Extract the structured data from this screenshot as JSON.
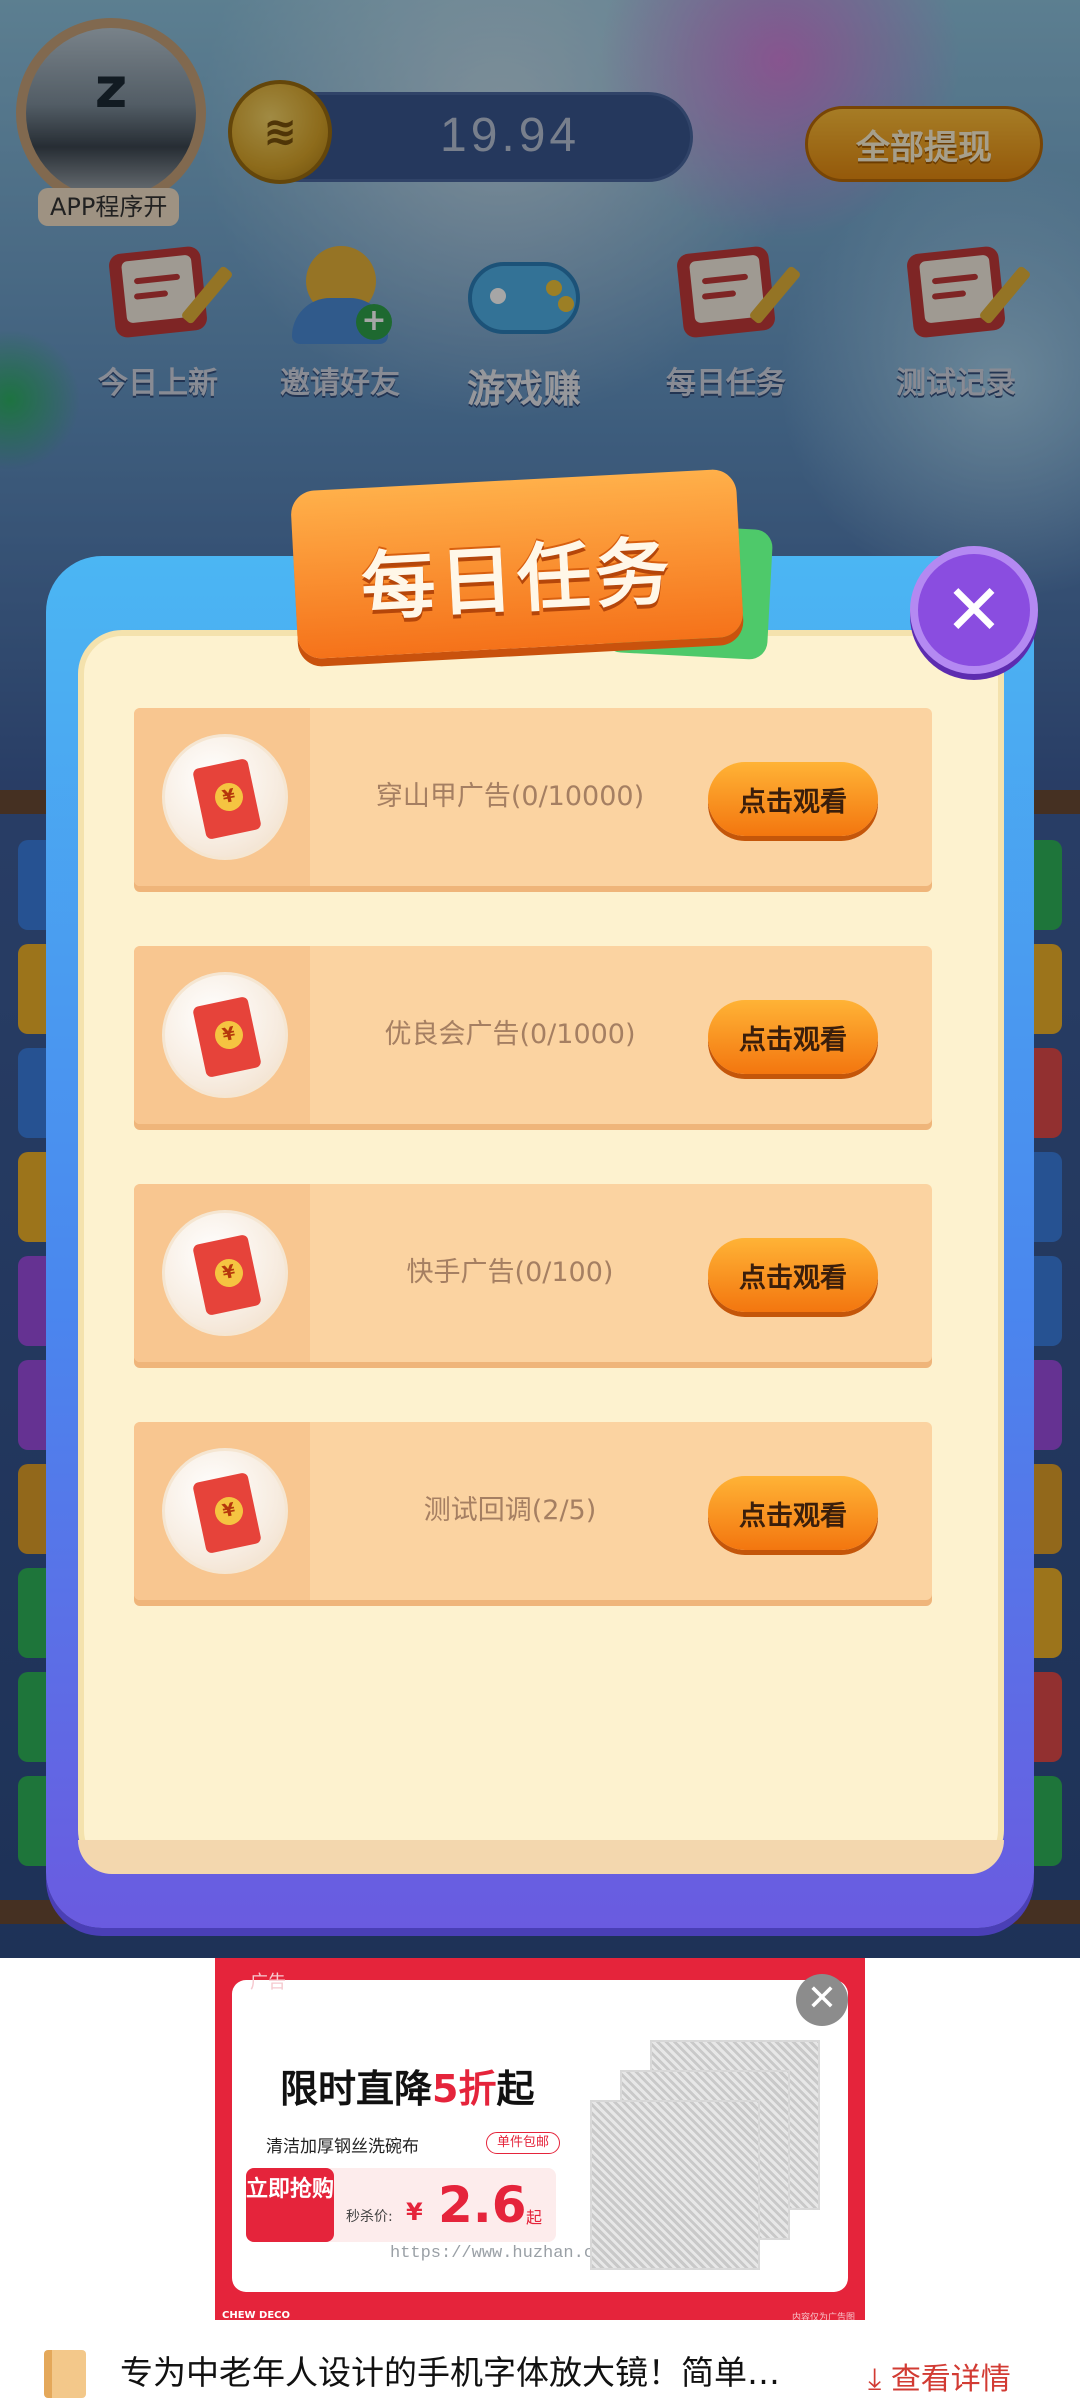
{
  "user": {
    "name": "APP程序开"
  },
  "balance": {
    "value": "19.94"
  },
  "header": {
    "withdraw_label": "全部提现"
  },
  "nav": {
    "items": [
      {
        "label": "今日上新",
        "icon": "document-pencil-icon"
      },
      {
        "label": "邀请好友",
        "icon": "add-friend-icon"
      },
      {
        "label": "游戏赚",
        "icon": "gamepad-coins-icon"
      },
      {
        "label": "每日任务",
        "icon": "document-pencil-icon"
      },
      {
        "label": "测试记录",
        "icon": "document-pencil-icon"
      }
    ]
  },
  "dialog": {
    "title": "每日任务",
    "close_icon": "close-icon",
    "tasks": [
      {
        "label": "穿山甲广告(0/10000)",
        "button": "点击观看",
        "icon": "red-envelope-icon"
      },
      {
        "label": "优良会广告(0/1000)",
        "button": "点击观看",
        "icon": "red-envelope-icon"
      },
      {
        "label": "快手广告(0/100)",
        "button": "点击观看",
        "icon": "red-envelope-icon"
      },
      {
        "label": "测试回调(2/5)",
        "button": "点击观看",
        "icon": "red-envelope-icon"
      }
    ]
  },
  "ad": {
    "tag": "广告",
    "headline_prefix": "限时直降",
    "headline_highlight": "5折",
    "headline_suffix": "起",
    "product": "清洁加厚钢丝洗碗布",
    "badge": "单件包邮",
    "buy_label": "立即抢购",
    "price_label": "秒杀价:",
    "currency": "¥",
    "price": "2.6",
    "price_suffix": "起",
    "watermark": "https://www.huzhan.com/ishop26328",
    "brand": "CHEW DECO",
    "note": "内容仅为广告图"
  },
  "info_bar": {
    "text": "专为中老年人设计的手机字体放大镜！简单…",
    "link": "查看详情",
    "icon": "book-icon",
    "link_icon": "download-arrow-icon"
  },
  "colors": {
    "dialog_blue": "#4bb6f3",
    "title_orange": "#f5721a",
    "button_orange": "#f3760f",
    "ad_red": "#e5243b",
    "link_red": "#d23b33"
  }
}
